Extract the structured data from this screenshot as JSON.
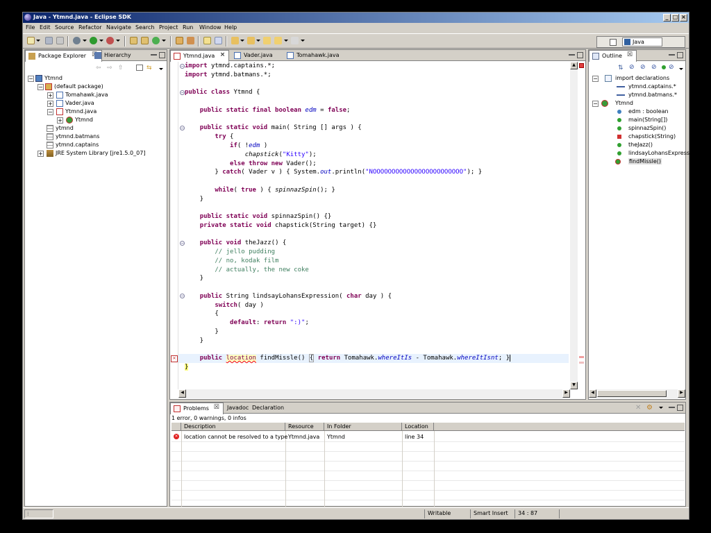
{
  "window": {
    "title": "Java - Ytmnd.java - Eclipse SDK"
  },
  "menu": [
    "File",
    "Edit",
    "Source",
    "Refactor",
    "Navigate",
    "Search",
    "Project",
    "Run",
    "Window",
    "Help"
  ],
  "perspective": {
    "label": "Java"
  },
  "package_explorer": {
    "tabs": [
      "Package Explorer",
      "Hierarchy"
    ],
    "tree": [
      {
        "label": "Ytmnd",
        "icon": "project-icon"
      },
      {
        "label": "(default package)",
        "icon": "package-icon"
      },
      {
        "label": "Tomahawk.java",
        "icon": "java-file-icon"
      },
      {
        "label": "Vader.java",
        "icon": "java-file-icon"
      },
      {
        "label": "Ytmnd.java",
        "icon": "java-file-error-icon"
      },
      {
        "label": "Ytmnd",
        "icon": "class-icon"
      },
      {
        "label": "ytmnd",
        "icon": "package-icon"
      },
      {
        "label": "ytmnd.batmans",
        "icon": "package-icon"
      },
      {
        "label": "ytmnd.captains",
        "icon": "package-icon"
      },
      {
        "label": "JRE System Library [jre1.5.0_07]",
        "icon": "library-icon"
      }
    ]
  },
  "editor": {
    "tabs": [
      "Ytmnd.java",
      "Vader.java",
      "Tomahawk.java"
    ],
    "lines": [
      "import ytmnd.captains.*;",
      "import ytmnd.batmans.*;",
      "",
      "public class Ytmnd {",
      "",
      "    public static final boolean edm = false;",
      "",
      "    public static void main( String [] args ) {",
      "        try {",
      "            if( !edm )",
      "                chapstick(\"Kitty\");",
      "            else throw new Vader();",
      "        } catch( Vader v ) { System.out.println(\"NOOOOOOOOOOOOOOOOOOOOOOOO\"); }",
      "",
      "        while( true ) { spinnazSpin(); }",
      "    }",
      "",
      "    public static void spinnazSpin() {}",
      "    private static void chapstick(String target) {}",
      "",
      "    public void theJazz() {",
      "        // jello pudding",
      "        // no, kodak film",
      "        // actually, the new coke",
      "    }",
      "",
      "    public String lindsayLohansExpression( char day ) {",
      "        switch( day )",
      "        {",
      "            default: return \":)\";",
      "        }",
      "    }",
      "",
      "    public location findMissle() { return Tomahawk.whereItIs - Tomahawk.whereItIsnt; }",
      "}"
    ]
  },
  "outline": {
    "tab": "Outline",
    "items": [
      {
        "label": "import declarations",
        "icon": "imports-icon"
      },
      {
        "label": "ytmnd.captains.*",
        "icon": "import-icon"
      },
      {
        "label": "ytmnd.batmans.*",
        "icon": "import-icon"
      },
      {
        "label": "Ytmnd",
        "icon": "class-icon"
      },
      {
        "label": "edm : boolean",
        "icon": "field-icon"
      },
      {
        "label": "main(String[])",
        "icon": "method-icon"
      },
      {
        "label": "spinnazSpin()",
        "icon": "method-icon"
      },
      {
        "label": "chapstick(String)",
        "icon": "private-method-icon"
      },
      {
        "label": "theJazz()",
        "icon": "method-icon"
      },
      {
        "label": "lindsayLohansExpressi",
        "icon": "method-icon"
      },
      {
        "label": "findMissle()",
        "icon": "method-error-icon"
      }
    ]
  },
  "problems": {
    "tabs": [
      "Problems",
      "Javadoc",
      "Declaration"
    ],
    "summary": "1 error, 0 warnings, 0 infos",
    "columns": [
      "Description",
      "Resource",
      "In Folder",
      "Location"
    ],
    "rows": [
      {
        "description": "location cannot be resolved to a type",
        "resource": "Ytmnd.java",
        "folder": "Ytmnd",
        "location": "line 34"
      }
    ]
  },
  "status": {
    "writable": "Writable",
    "insert": "Smart Insert",
    "position": "34 : 87"
  },
  "colors": {
    "keyword": "#7f0055",
    "comment": "#3f7f5f",
    "string": "#2a00ff",
    "title_start": "#0a246a",
    "title_end": "#a6caf0"
  }
}
